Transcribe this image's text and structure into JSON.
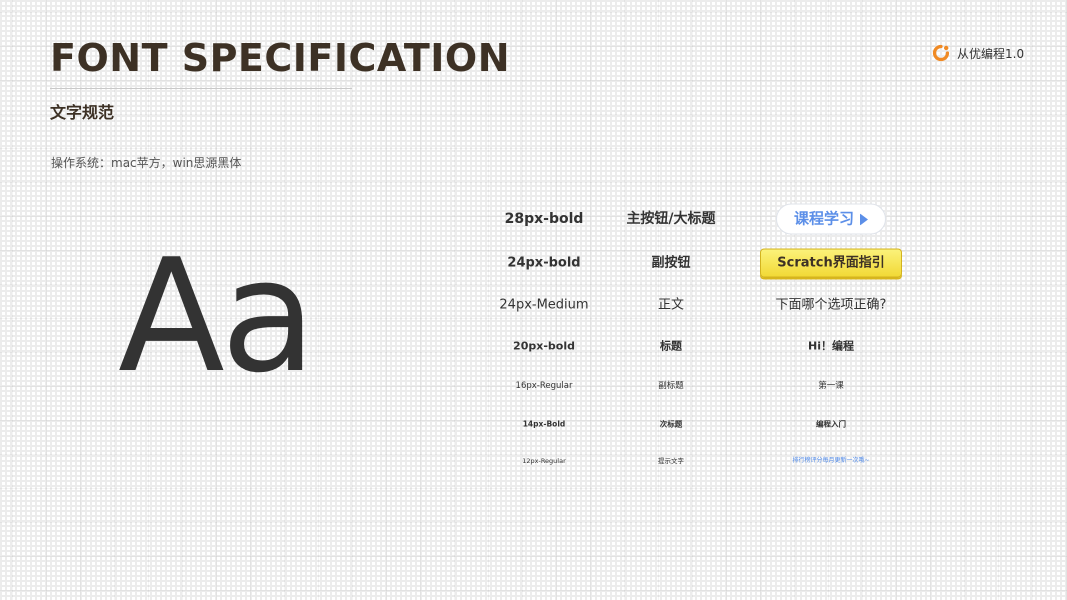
{
  "header": {
    "title": "FONT SPECIFICATION",
    "subtitle": "文字规范",
    "os_note": "操作系统：mac苹方，win思源黑体"
  },
  "brand": {
    "name": "从优编程1.0",
    "logo_icon": "refresh-circle-icon",
    "logo_color": "#f08a24"
  },
  "sample_glyphs": "Aa",
  "colors": {
    "heading": "#3d3125",
    "text": "#333333",
    "primary_button_text": "#5c8fe8",
    "secondary_button_fill": "#f2d936",
    "hint_link": "#4a86e8"
  },
  "spec_rows": [
    {
      "spec": "28px-bold",
      "usage": "主按钮/大标题",
      "example": "课程学习",
      "example_icon": "play-icon"
    },
    {
      "spec": "24px-bold",
      "usage": "副按钮",
      "example": "Scratch界面指引"
    },
    {
      "spec": "24px-Medium",
      "usage": "正文",
      "example": "下面哪个选项正确?"
    },
    {
      "spec": "20px-bold",
      "usage": "标题",
      "example": "Hi！编程"
    },
    {
      "spec": "16px-Regular",
      "usage": "副标题",
      "example": "第一课"
    },
    {
      "spec": "14px-Bold",
      "usage": "次标题",
      "example": "编程入门"
    },
    {
      "spec": "12px-Regular",
      "usage": "提示文字",
      "example": "排行榜评分每月更新一次哦~"
    }
  ]
}
